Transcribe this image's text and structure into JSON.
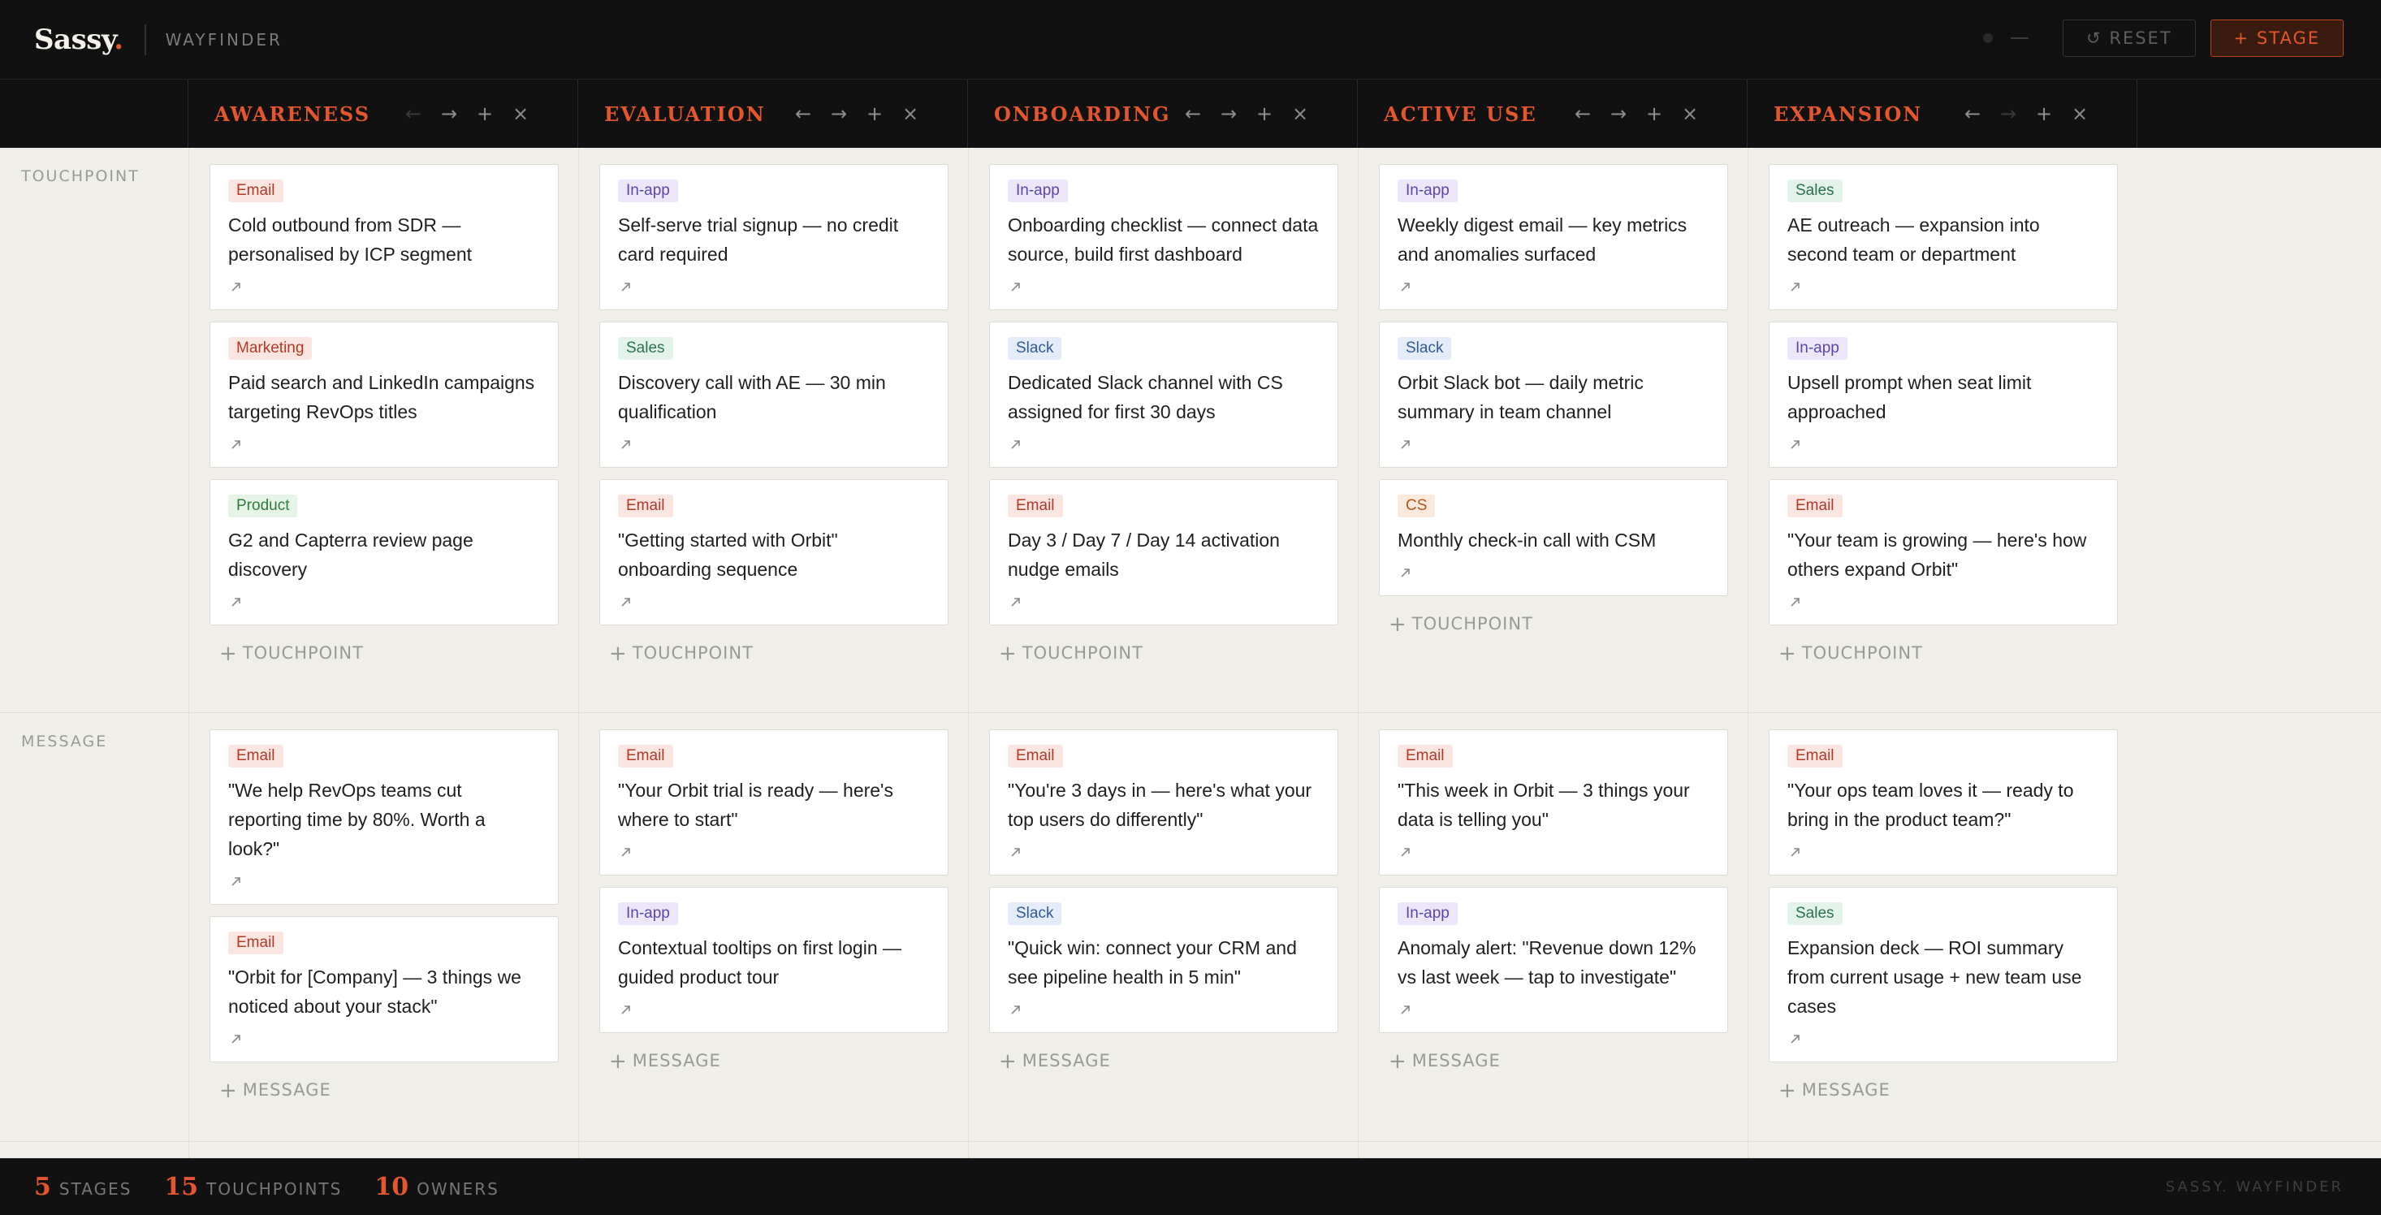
{
  "app": {
    "logo": "Sassy",
    "logo_dot": ".",
    "name": "WAYFINDER",
    "reset_label": "↺ RESET",
    "add_stage_label": "+ STAGE"
  },
  "stages": [
    {
      "title": "AWARENESS",
      "left": "←",
      "right": "→",
      "add": "+",
      "remove": "×"
    },
    {
      "title": "EVALUATION",
      "left": "←",
      "right": "→",
      "add": "+",
      "remove": "×"
    },
    {
      "title": "ONBOARDING",
      "left": "←",
      "right": "→",
      "add": "+",
      "remove": "×"
    },
    {
      "title": "ACTIVE USE",
      "left": "←",
      "right": "→",
      "add": "+",
      "remove": "×"
    },
    {
      "title": "EXPANSION",
      "left": "←",
      "right": "→",
      "add": "+",
      "remove": "×"
    }
  ],
  "lanes": {
    "touchpoint": {
      "label": "TOUCHPOINT",
      "add_label": "TOUCHPOINT",
      "columns": [
        [
          {
            "tag": "Email",
            "text": "Cold outbound from SDR — personalised by ICP segment"
          },
          {
            "tag": "Marketing",
            "text": "Paid search and LinkedIn campaigns targeting RevOps titles"
          },
          {
            "tag": "Product",
            "text": "G2 and Capterra review page discovery"
          }
        ],
        [
          {
            "tag": "In-app",
            "text": "Self-serve trial signup — no credit card required"
          },
          {
            "tag": "Sales",
            "text": "Discovery call with AE — 30 min qualification"
          },
          {
            "tag": "Email",
            "text": "\"Getting started with Orbit\" onboarding sequence"
          }
        ],
        [
          {
            "tag": "In-app",
            "text": "Onboarding checklist — connect data source, build first dashboard"
          },
          {
            "tag": "Slack",
            "text": "Dedicated Slack channel with CS assigned for first 30 days"
          },
          {
            "tag": "Email",
            "text": "Day 3 / Day 7 / Day 14 activation nudge emails"
          }
        ],
        [
          {
            "tag": "In-app",
            "text": "Weekly digest email — key metrics and anomalies surfaced"
          },
          {
            "tag": "Slack",
            "text": "Orbit Slack bot — daily metric summary in team channel"
          },
          {
            "tag": "CS",
            "text": "Monthly check-in call with CSM"
          }
        ],
        [
          {
            "tag": "Sales",
            "text": "AE outreach — expansion into second team or department"
          },
          {
            "tag": "In-app",
            "text": "Upsell prompt when seat limit approached"
          },
          {
            "tag": "Email",
            "text": "\"Your team is growing — here's how others expand Orbit\""
          }
        ]
      ]
    },
    "message": {
      "label": "MESSAGE",
      "add_label": "MESSAGE",
      "columns": [
        [
          {
            "tag": "Email",
            "text": "\"We help RevOps teams cut reporting time by 80%. Worth a look?\""
          },
          {
            "tag": "Email",
            "text": "\"Orbit for [Company] — 3 things we noticed about your stack\""
          }
        ],
        [
          {
            "tag": "Email",
            "text": "\"Your Orbit trial is ready — here's where to start\""
          },
          {
            "tag": "In-app",
            "text": "Contextual tooltips on first login — guided product tour"
          }
        ],
        [
          {
            "tag": "Email",
            "text": "\"You're 3 days in — here's what your top users do differently\""
          },
          {
            "tag": "Slack",
            "text": "\"Quick win: connect your CRM and see pipeline health in 5 min\""
          }
        ],
        [
          {
            "tag": "Email",
            "text": "\"This week in Orbit — 3 things your data is telling you\""
          },
          {
            "tag": "In-app",
            "text": "Anomaly alert: \"Revenue down 12% vs last week — tap to investigate\""
          }
        ],
        [
          {
            "tag": "Email",
            "text": "\"Your ops team loves it — ready to bring in the product team?\""
          },
          {
            "tag": "Sales",
            "text": "Expansion deck — ROI summary from current usage + new team use cases"
          }
        ]
      ]
    }
  },
  "footer": {
    "stages_count": "5",
    "stages_label": "STAGES",
    "touchpoints_count": "15",
    "touchpoints_label": "TOUCHPOINTS",
    "owners_count": "10",
    "owners_label": "OWNERS",
    "brand": "SASSY. WAYFINDER"
  },
  "icons": {
    "card_link": "arrow-up-right-icon",
    "add": "plus-icon"
  }
}
